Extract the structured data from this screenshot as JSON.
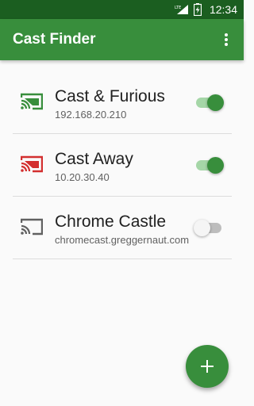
{
  "status_bar": {
    "network_label": "LTE",
    "battery_icon": "battery-charging-icon",
    "time": "12:34"
  },
  "app_bar": {
    "title": "Cast Finder",
    "menu_icon": "more-vert-icon",
    "color": "#388e3c"
  },
  "devices": [
    {
      "name": "Cast & Furious",
      "address": "192.168.20.210",
      "icon": "cast-connected-icon",
      "icon_color": "#388e3c",
      "enabled": true
    },
    {
      "name": "Cast Away",
      "address": "10.20.30.40",
      "icon": "cast-connected-icon",
      "icon_color": "#d32f2f",
      "enabled": true
    },
    {
      "name": "Chrome Castle",
      "address": "chromecast.greggernaut.com",
      "icon": "cast-icon",
      "icon_color": "#616161",
      "enabled": false
    }
  ],
  "fab": {
    "icon": "add-icon",
    "label": "+"
  }
}
